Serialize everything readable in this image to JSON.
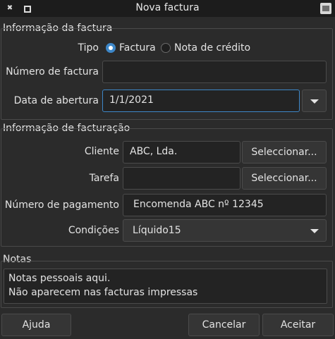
{
  "window": {
    "title": "Nova factura"
  },
  "invoice_info": {
    "group_title": "Informação da factura",
    "type_label": "Tipo",
    "type_options": [
      "Factura",
      "Nota de crédito"
    ],
    "type_selected": "Factura",
    "number_label": "Número de factura",
    "number_value": "",
    "date_label": "Data de abertura",
    "date_value": "1/1/2021"
  },
  "billing_info": {
    "group_title": "Informação de facturação",
    "client_label": "Cliente",
    "client_value": "ABC, Lda.",
    "client_button": "Seleccionar...",
    "task_label": "Tarefa",
    "task_value": "",
    "task_button": "Seleccionar...",
    "payment_label": "Número de pagamento",
    "payment_value": "Encomenda ABC nº 12345",
    "terms_label": "Condições",
    "terms_value": "Líquido15"
  },
  "notes": {
    "group_title": "Notas",
    "lines": [
      "Notas pessoais aqui.",
      "Não aparecem nas facturas impressas"
    ]
  },
  "buttons": {
    "help": "Ajuda",
    "cancel": "Cancelar",
    "accept": "Aceitar"
  }
}
